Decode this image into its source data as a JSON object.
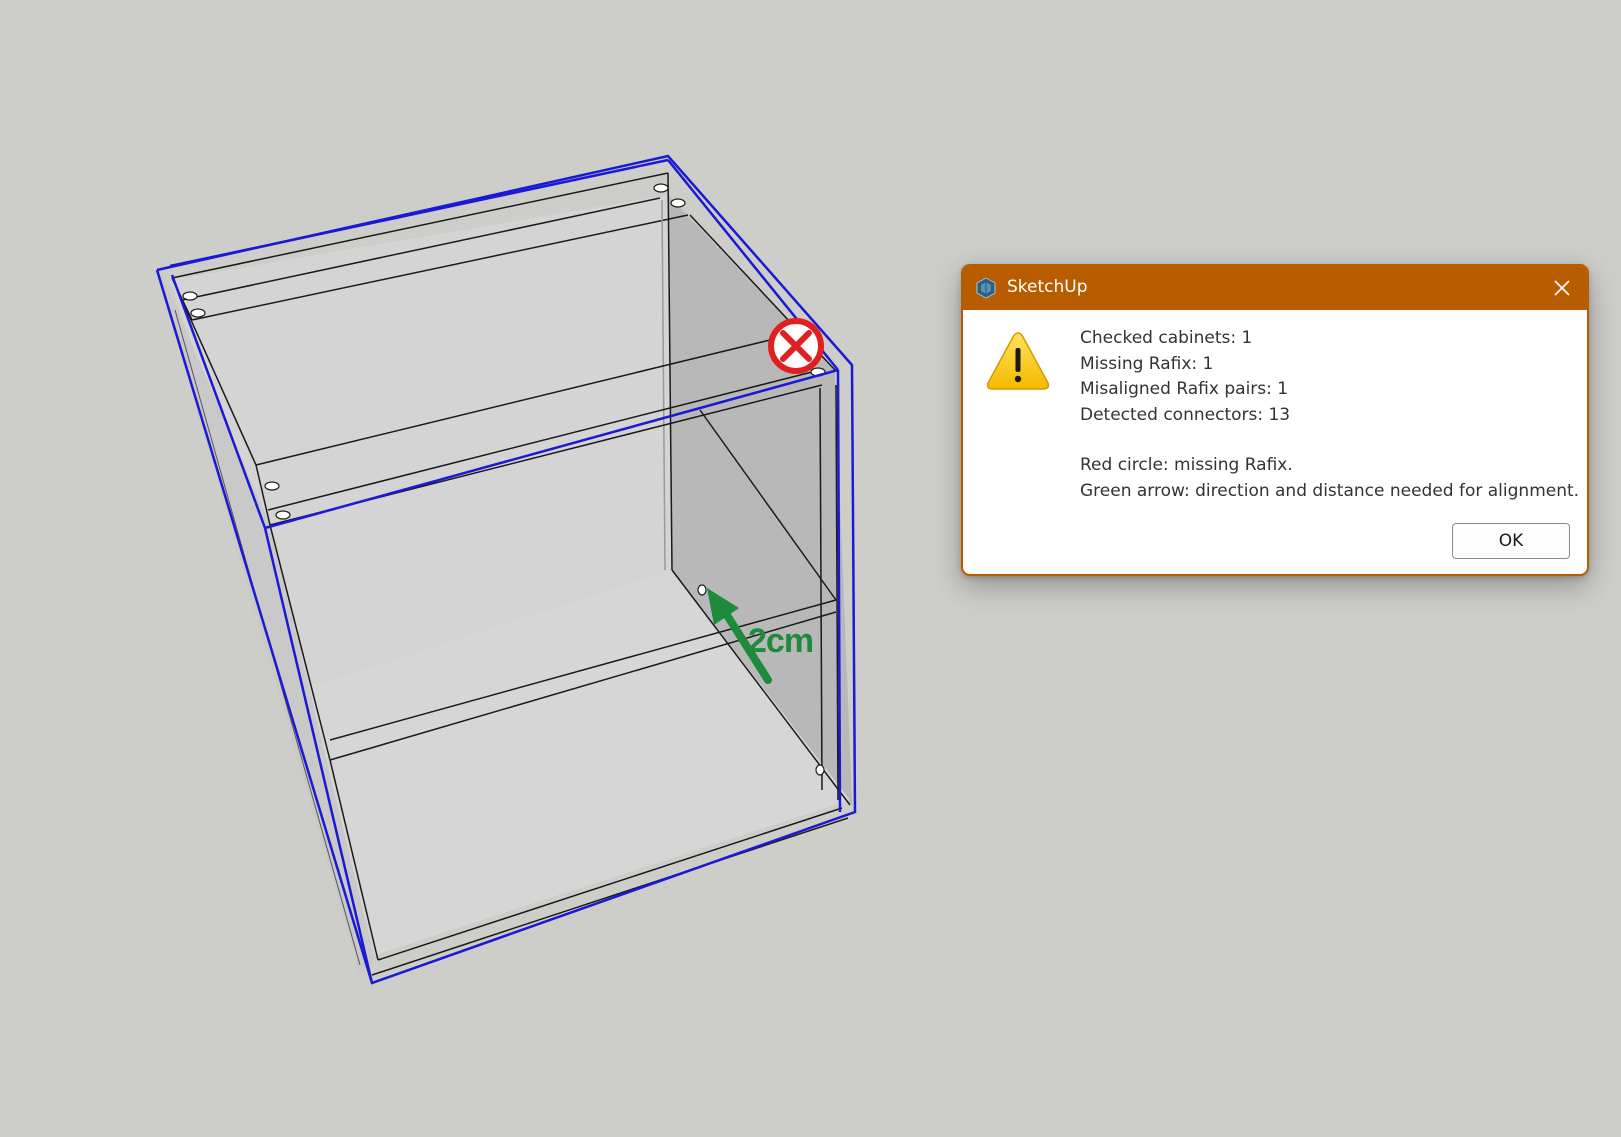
{
  "viewport": {
    "dimension_label": "2cm",
    "selection_color": "#1a1ad6",
    "missing_marker_color": "#e02020",
    "alignment_arrow_color": "#1e8a3c"
  },
  "dialog": {
    "title": "SketchUp",
    "titlebar_color": "#b85c00",
    "icon": "warning-icon",
    "lines": [
      "Checked cabinets: 1",
      "Missing Rafix: 1",
      "Misaligned Rafix pairs: 1",
      "Detected connectors: 13"
    ],
    "notes": [
      "Red circle: missing Rafix.",
      "Green arrow: direction and distance needed for alignment."
    ],
    "ok_label": "OK"
  }
}
